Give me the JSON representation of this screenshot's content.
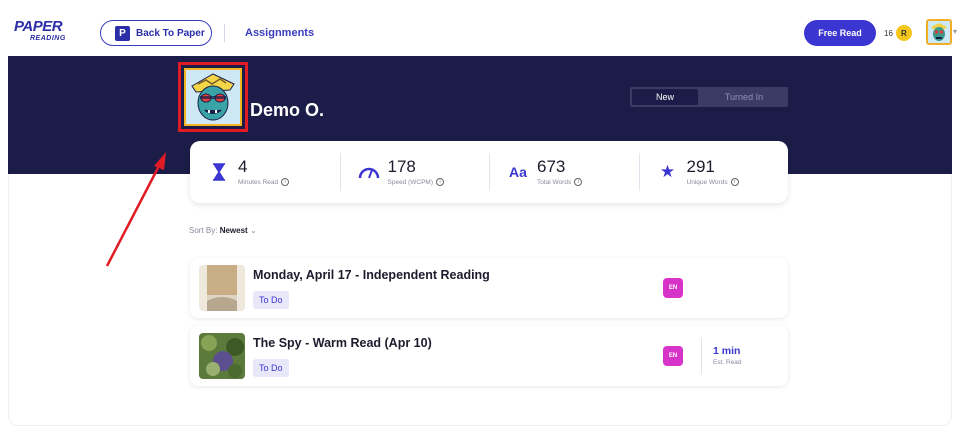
{
  "nav": {
    "logo_top": "PAPER",
    "logo_bottom": "READING",
    "back_label": "Back To Paper",
    "back_icon_letter": "P",
    "assignments_label": "Assignments",
    "free_read_label": "Free Read",
    "coin_count": "16",
    "coin_letter": "R"
  },
  "hero": {
    "student_name": "Demo O.",
    "tabs": [
      {
        "label": "New",
        "active": true
      },
      {
        "label": "Turned In",
        "active": false
      }
    ]
  },
  "stats": [
    {
      "icon": "hourglass-icon",
      "value": "4",
      "label": "Minutes Read"
    },
    {
      "icon": "speedometer-icon",
      "value": "178",
      "label": "Speed (WCPM)"
    },
    {
      "icon": "text-size-icon",
      "value": "673",
      "label": "Total Words"
    },
    {
      "icon": "star-icon",
      "value": "291",
      "label": "Unique Words"
    }
  ],
  "stat_icon_glyphs": {
    "minutes": "⧗",
    "speed": "◠",
    "words": "Aa",
    "star": "★"
  },
  "sort": {
    "prefix": "Sort By:",
    "value": "Newest"
  },
  "assignments": [
    {
      "title": "Monday, April 17 - Independent Reading",
      "status": "To Do",
      "lang": "EN",
      "duration": "",
      "duration_sub": ""
    },
    {
      "title": "The Spy - Warm Read (Apr 10)",
      "status": "To Do",
      "lang": "EN",
      "duration": "1 min",
      "duration_sub": "Est. Read"
    }
  ],
  "colors": {
    "brand": "#2b2ea8",
    "accent": "#3b36d1",
    "hero_bg": "#1b1d48",
    "highlight": "#e01b24",
    "lang_badge": "#d833c9"
  }
}
